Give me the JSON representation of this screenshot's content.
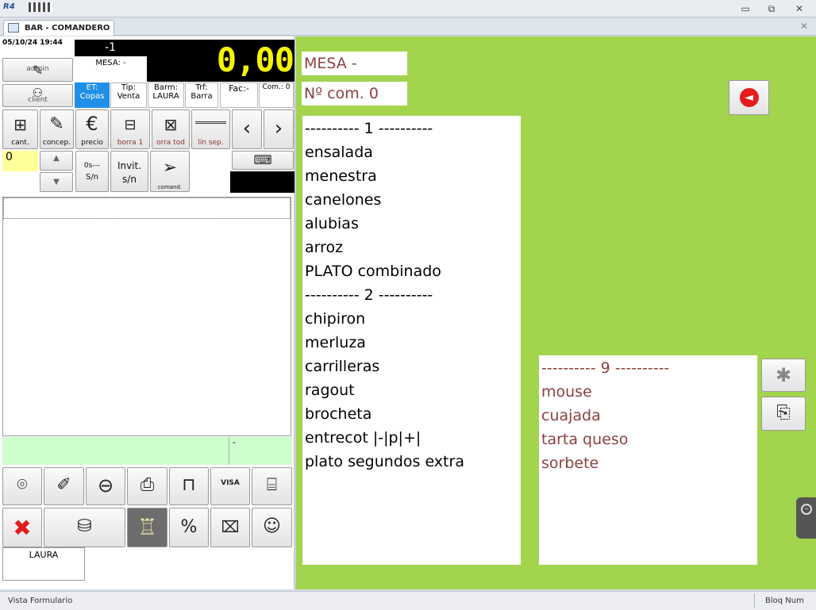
{
  "app": {
    "logo": "R4",
    "title": "R4"
  },
  "tab": {
    "label": "BAR - COMANDERO"
  },
  "window_controls": {
    "minimize": "▭",
    "restore": "⧉",
    "close": "✕"
  },
  "header": {
    "datetime": "05/10/24 19:44",
    "counter": "-1",
    "mesa": "MESA: -",
    "total": "0,00",
    "admin_label": "admin",
    "client_label": "client",
    "et_label": "ET:",
    "et_value": "Copas",
    "tip_label": "Tip:",
    "tip_value": "Venta",
    "barm_label": "Barm:",
    "barm_value": "LAURA",
    "trf_label": "Trf:",
    "trf_value": "Barra",
    "fac": "Fac:-",
    "com": "Com.: 0"
  },
  "toolbar": {
    "cant": "cant.",
    "concep": "concep.",
    "precio": "precio",
    "borra1": "borra 1",
    "borratod": "orra tod",
    "linsep": "lín sep.",
    "qty_value": "0",
    "os_label": "0s---",
    "sn_label": "S/n",
    "invit_label": "Invit.",
    "invit_sn": "s/n",
    "comand": "comand."
  },
  "summary": {
    "dash": "-"
  },
  "footer_user": "LAURA",
  "main": {
    "mesa_title": "MESA -",
    "ncom": "Nº com. 0",
    "list1": [
      "---------- 1 ----------",
      "ensalada",
      "menestra",
      "canelones",
      "alubias",
      "arroz",
      "PLATO combinado",
      "---------- 2 ----------",
      "chipiron",
      "merluza",
      "carrilleras",
      "ragout",
      "brocheta",
      "entrecot |-|p|+|",
      "plato segundos extra"
    ],
    "list2": [
      "---------- 9 ----------",
      "mouse",
      "cuajada",
      "tarta queso",
      "sorbete"
    ]
  },
  "status": {
    "left": "Vista Formulario",
    "right": "Bloq Num"
  },
  "colors": {
    "green_bg": "#a2d44d",
    "display_yellow": "#f5f500",
    "brown_text": "#8b4040",
    "et_blue": "#1f8fe8"
  }
}
